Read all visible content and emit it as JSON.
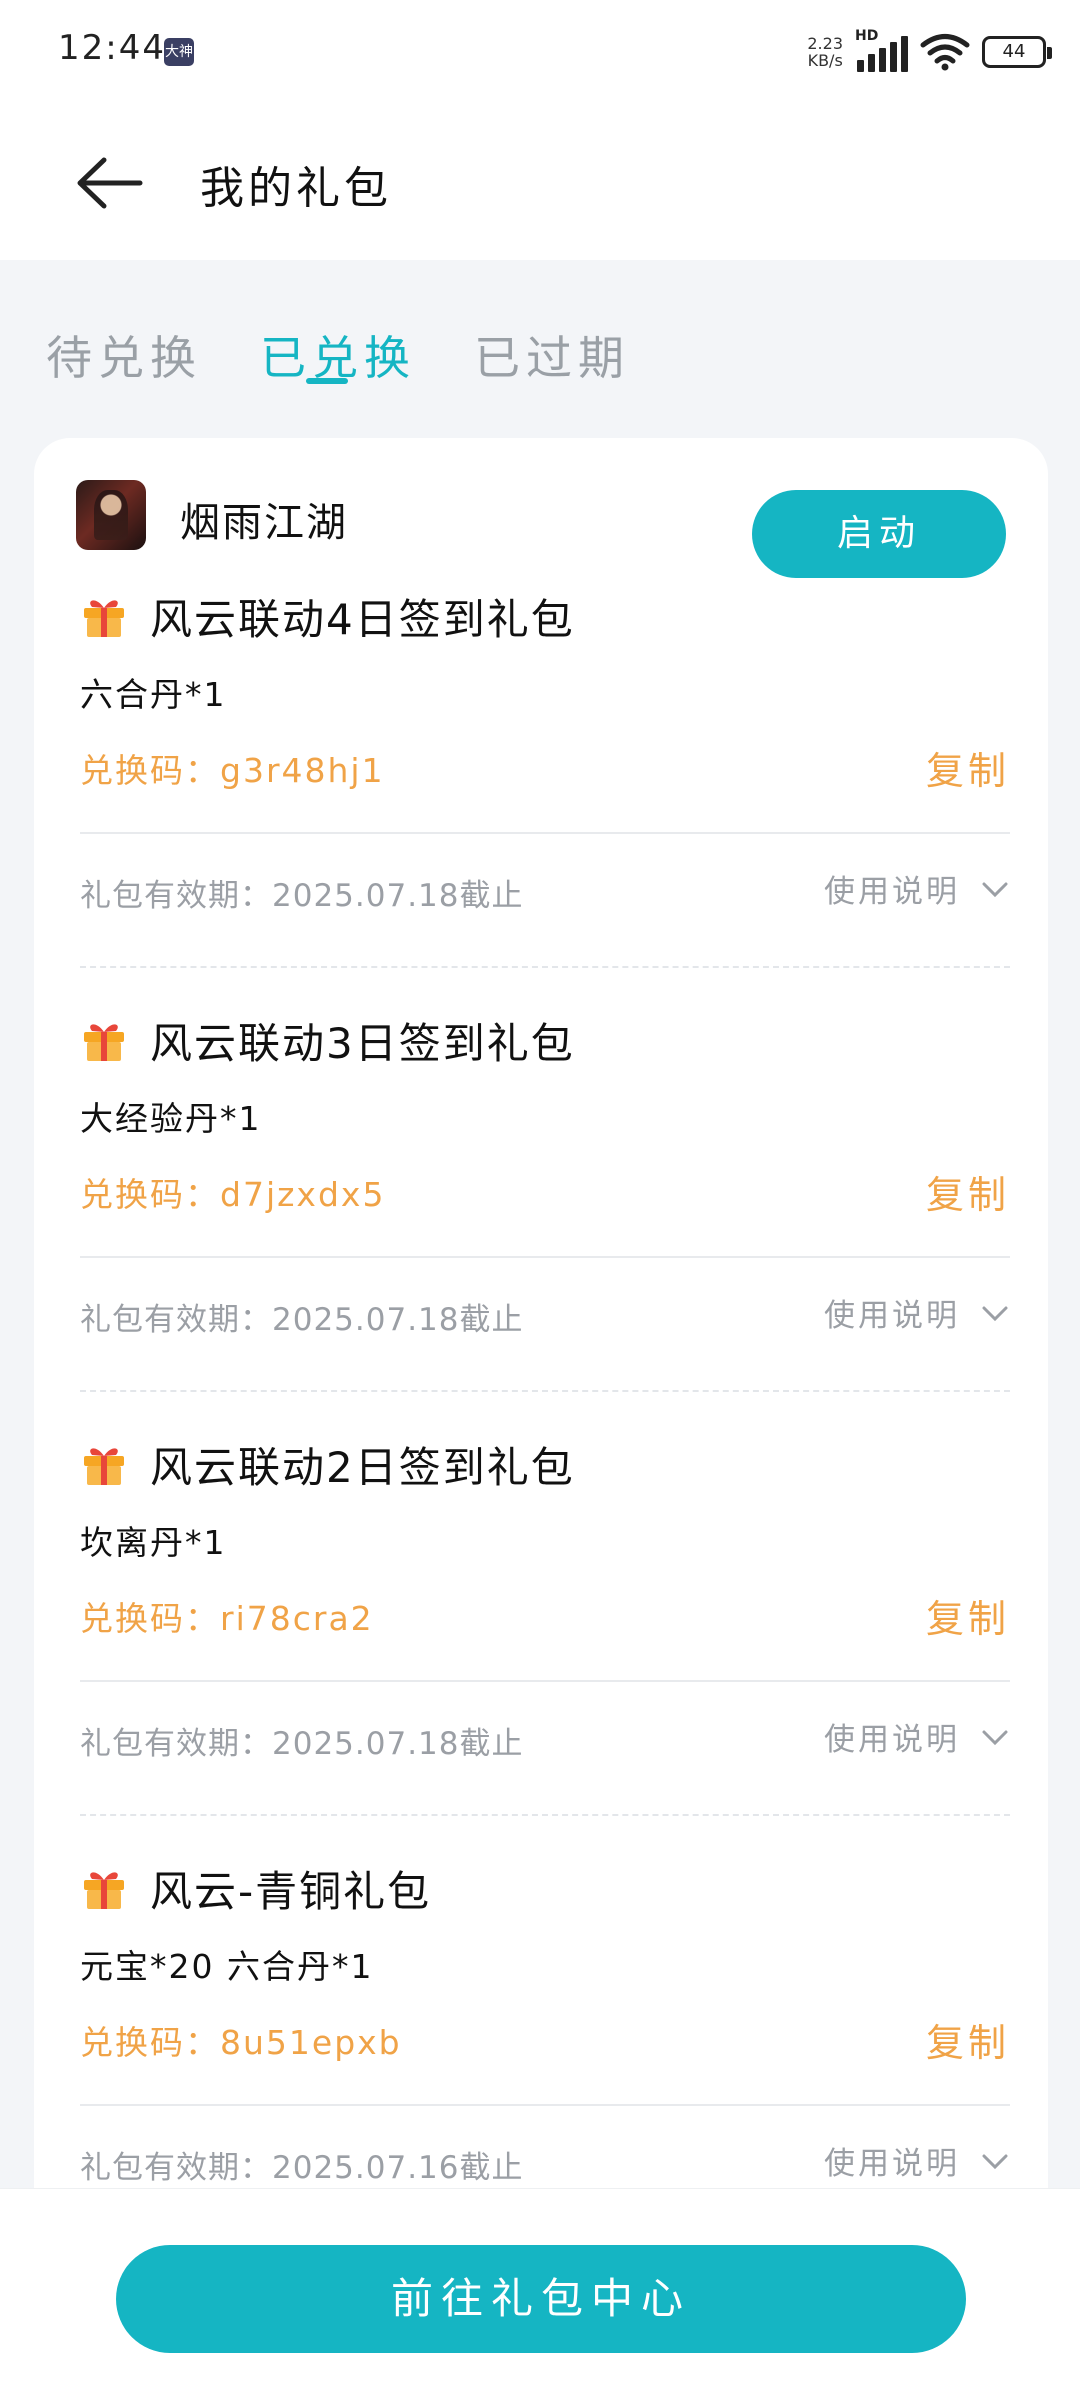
{
  "status_bar": {
    "time": "12:44",
    "app_badge": "大神",
    "net_speed_value": "2.23",
    "net_speed_unit": "KB/s",
    "network_label": "HD",
    "battery": "44"
  },
  "header": {
    "title": "我的礼包"
  },
  "tabs": [
    {
      "label": "待兑换",
      "active": false
    },
    {
      "label": "已兑换",
      "active": true
    },
    {
      "label": "已过期",
      "active": false
    }
  ],
  "game": {
    "name": "烟雨江湖",
    "launch_label": "启动"
  },
  "gifts": [
    {
      "title": "风云联动4日签到礼包",
      "content": "六合丹*1",
      "code_label": "兑换码：g3r48hj1",
      "copy_label": "复制",
      "expiry": "礼包有效期：2025.07.18截止",
      "usage_label": "使用说明"
    },
    {
      "title": "风云联动3日签到礼包",
      "content": "大经验丹*1",
      "code_label": "兑换码：d7jzxdx5",
      "copy_label": "复制",
      "expiry": "礼包有效期：2025.07.18截止",
      "usage_label": "使用说明"
    },
    {
      "title": "风云联动2日签到礼包",
      "content": "坎离丹*1",
      "code_label": "兑换码：ri78cra2",
      "copy_label": "复制",
      "expiry": "礼包有效期：2025.07.18截止",
      "usage_label": "使用说明"
    },
    {
      "title": "风云-青铜礼包",
      "content": "元宝*20 六合丹*1",
      "code_label": "兑换码：8u51epxb",
      "copy_label": "复制",
      "expiry": "礼包有效期：2025.07.16截止",
      "usage_label": "使用说明"
    }
  ],
  "bottom": {
    "button_label": "前往礼包中心"
  },
  "colors": {
    "accent": "#15b5c3",
    "code_orange": "#f0a347",
    "muted_gray": "#9b9fa5",
    "background": "#f3f5f8"
  },
  "icons": [
    "back-arrow-icon",
    "gift-icon",
    "chevron-down-icon",
    "wifi-icon",
    "signal-icon",
    "battery-icon"
  ]
}
